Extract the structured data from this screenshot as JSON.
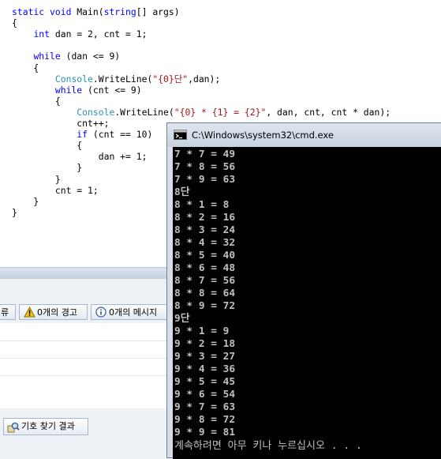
{
  "editor": {
    "lines": [
      [
        {
          "t": "static void",
          "c": "kw"
        },
        {
          "t": " Main("
        },
        {
          "t": "string",
          "c": "kw"
        },
        {
          "t": "[] args)"
        }
      ],
      [
        {
          "t": "{"
        }
      ],
      [
        {
          "t": "    "
        },
        {
          "t": "int",
          "c": "kw"
        },
        {
          "t": " dan = 2, cnt = 1;"
        }
      ],
      [],
      [
        {
          "t": "    "
        },
        {
          "t": "while",
          "c": "kw"
        },
        {
          "t": " (dan <= 9)"
        }
      ],
      [
        {
          "t": "    {"
        }
      ],
      [
        {
          "t": "        "
        },
        {
          "t": "Console",
          "c": "ty"
        },
        {
          "t": ".WriteLine("
        },
        {
          "t": "\"{0}단\"",
          "c": "st"
        },
        {
          "t": ",dan);"
        }
      ],
      [
        {
          "t": "        "
        },
        {
          "t": "while",
          "c": "kw"
        },
        {
          "t": " (cnt <= 9)"
        }
      ],
      [
        {
          "t": "        {"
        }
      ],
      [
        {
          "t": "            "
        },
        {
          "t": "Console",
          "c": "ty"
        },
        {
          "t": ".WriteLine("
        },
        {
          "t": "\"{0} * {1} = {2}\"",
          "c": "st"
        },
        {
          "t": ", dan, cnt, cnt * dan);"
        }
      ],
      [
        {
          "t": "            cnt++;"
        }
      ],
      [
        {
          "t": "            "
        },
        {
          "t": "if",
          "c": "kw"
        },
        {
          "t": " (cnt == 10)"
        }
      ],
      [
        {
          "t": "            {"
        }
      ],
      [
        {
          "t": "                dan += 1;"
        }
      ],
      [
        {
          "t": "            }"
        }
      ],
      [
        {
          "t": "        }"
        }
      ],
      [
        {
          "t": "        cnt = 1;"
        }
      ],
      [
        {
          "t": "    }"
        }
      ],
      [
        {
          "t": "}"
        }
      ]
    ]
  },
  "error_list": {
    "errors_label": "류",
    "warnings_label": "0개의 경고",
    "messages_label": "0개의 메시지",
    "symbol_tab_label": "기호 찾기 결과"
  },
  "console": {
    "title": "C:\\Windows\\system32\\cmd.exe",
    "output_lines": [
      "7 * 7 = 49",
      "7 * 8 = 56",
      "7 * 9 = 63",
      "8단",
      "8 * 1 = 8",
      "8 * 2 = 16",
      "8 * 3 = 24",
      "8 * 4 = 32",
      "8 * 5 = 40",
      "8 * 6 = 48",
      "8 * 7 = 56",
      "8 * 8 = 64",
      "8 * 9 = 72",
      "9단",
      "9 * 1 = 9",
      "9 * 2 = 18",
      "9 * 3 = 27",
      "9 * 4 = 36",
      "9 * 5 = 45",
      "9 * 6 = 54",
      "9 * 7 = 63",
      "9 * 8 = 72",
      "9 * 9 = 81"
    ],
    "prompt": "계속하려면 아무 키나 누르십시오 . . ."
  }
}
